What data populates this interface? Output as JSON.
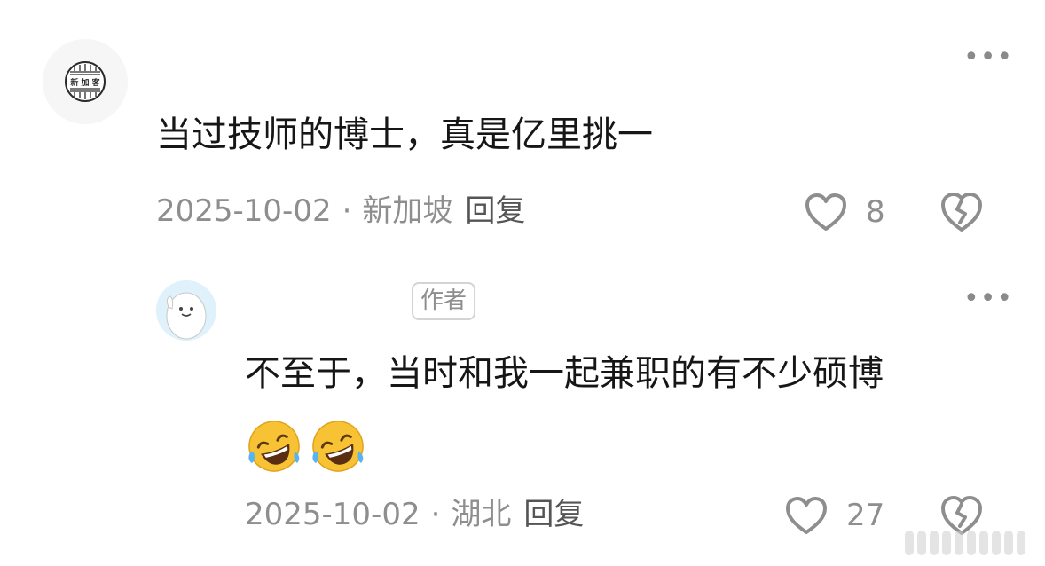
{
  "comments": [
    {
      "avatar_text": "新 加 客",
      "text": "当过技师的博士，真是亿里挑一",
      "date": "2025-10-02",
      "separator": "·",
      "location": "新加坡",
      "reply_label": "回复",
      "like_count": "8",
      "more_label": "•••"
    },
    {
      "badge": "作者",
      "text": "不至于，当时和我一起兼职的有不少硕博",
      "emoji_count": 2,
      "emoji_icon": "rofl-emoji-icon",
      "date": "2025-10-02",
      "separator": "·",
      "location": "湖北",
      "reply_label": "回复",
      "like_count": "27",
      "more_label": "•••"
    }
  ]
}
